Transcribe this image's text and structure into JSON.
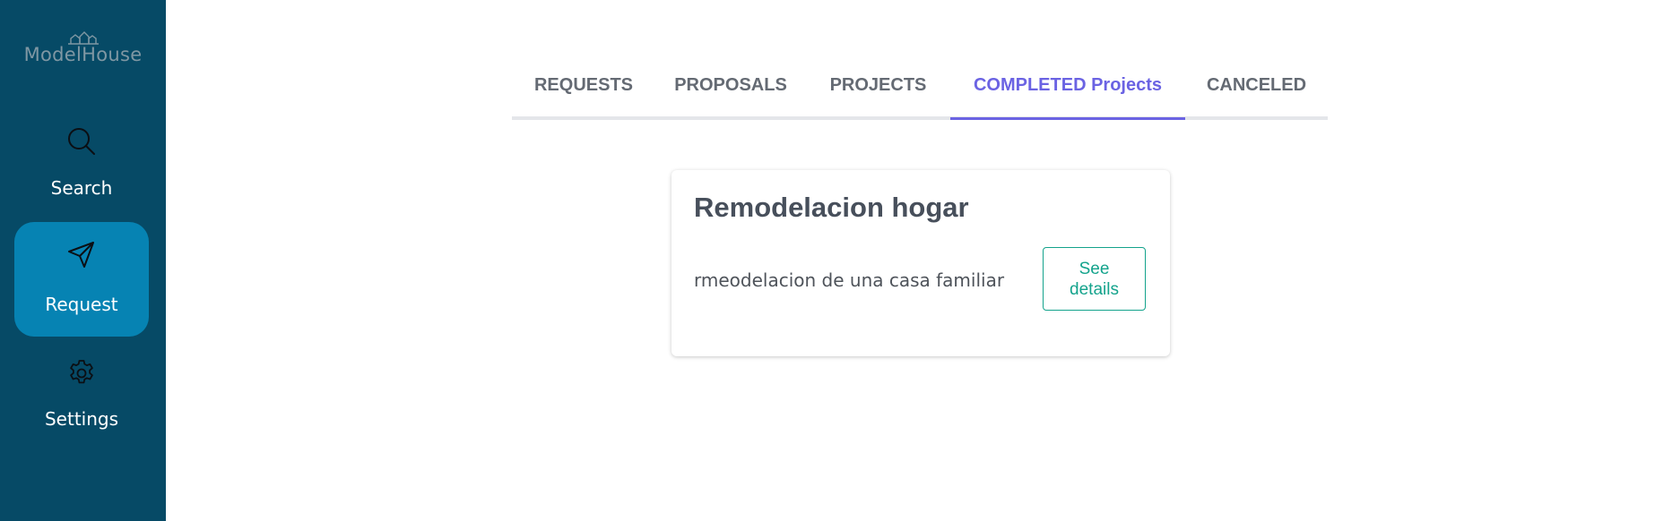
{
  "sidebar": {
    "logo_text": "ModelHouse",
    "items": [
      {
        "label": "Search",
        "icon": "search-icon"
      },
      {
        "label": "Request",
        "icon": "send-icon",
        "active": true
      },
      {
        "label": "Settings",
        "icon": "gear-icon"
      }
    ]
  },
  "tabs": [
    {
      "label": "REQUESTS"
    },
    {
      "label": "PROPOSALS"
    },
    {
      "label": "PROJECTS"
    },
    {
      "label": "COMPLETED Projects",
      "active": true
    },
    {
      "label": "CANCELED"
    }
  ],
  "card": {
    "title": "Remodelacion hogar",
    "description": "rmeodelacion de una casa familiar",
    "button_label": "See details"
  },
  "colors": {
    "sidebar_bg": "#064a66",
    "sidebar_active": "#0683b3",
    "tab_active": "#6b63e3",
    "button_accent": "#14a38c"
  }
}
